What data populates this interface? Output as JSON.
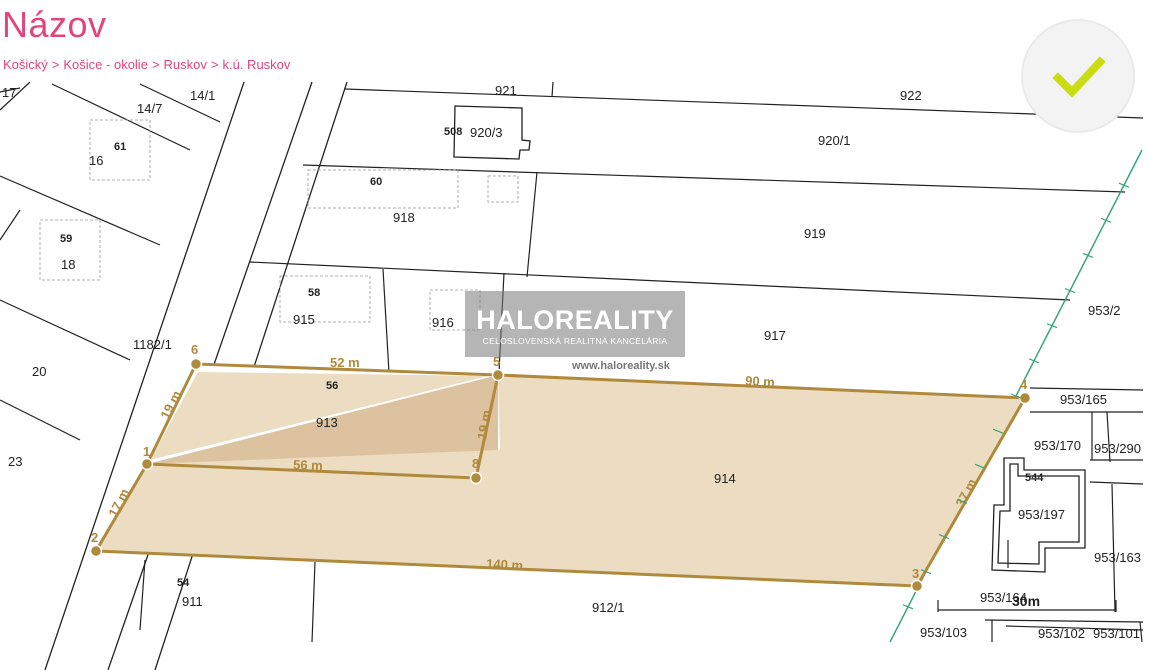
{
  "page": {
    "title": "Názov"
  },
  "breadcrumb": [
    {
      "label": "Košický"
    },
    {
      "label": "Košice - okolie"
    },
    {
      "label": "Ruskov"
    },
    {
      "label": "k.ú. Ruskov"
    }
  ],
  "breadcrumb_separator": ">",
  "watermark": {
    "brand": "HALOREALITY",
    "subtitle": "CELOSLOVENSKÁ REALITNÁ KANCELÁRIA",
    "url": "www.haloreality.sk"
  },
  "map": {
    "parcel_labels": [
      "17",
      "14/7",
      "14/1",
      "921",
      "922",
      "920/3",
      "920/1",
      "16",
      "918",
      "919",
      "18",
      "915",
      "916",
      "917",
      "1182/1",
      "953/2",
      "20",
      "953/165",
      "953/170",
      "953/290",
      "913",
      "914",
      "23",
      "953/197",
      "953/163",
      "911",
      "912/1",
      "953/164",
      "953/103",
      "953/102",
      "953/101"
    ],
    "building_numbers": [
      "61",
      "508",
      "60",
      "59",
      "58",
      "56",
      "54",
      "544"
    ],
    "plot_points": [
      "1",
      "2",
      "3",
      "4",
      "5",
      "6",
      "8"
    ],
    "dimensions": [
      "52 m",
      "90 m",
      "19 m",
      "19 m",
      "56 m",
      "17 m",
      "37 m",
      "140 m"
    ],
    "scale_label": "30m",
    "plot_fill_color": "#ecdcc1",
    "plot_shade_color": "#dcc29e",
    "boundary_color": "#b08a3c",
    "stream_color": "#3aa57a"
  },
  "badge": {
    "icon": "checkmark-icon",
    "color": "#c9dd12"
  }
}
